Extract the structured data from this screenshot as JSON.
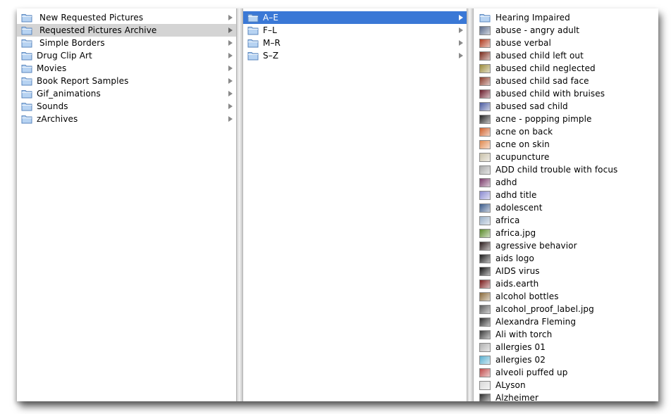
{
  "columns": [
    {
      "items": [
        {
          "label": "New Requested Pictures",
          "type": "folder",
          "padded": true
        },
        {
          "label": "Requested Pictures Archive",
          "type": "folder",
          "padded": true,
          "state": "selected-inactive"
        },
        {
          "label": "Simple Borders",
          "type": "folder",
          "padded": true
        },
        {
          "label": "Drug Clip Art",
          "type": "folder"
        },
        {
          "label": "Movies",
          "type": "folder"
        },
        {
          "label": "Book Report Samples",
          "type": "folder"
        },
        {
          "label": "Gif_animations",
          "type": "folder"
        },
        {
          "label": "Sounds",
          "type": "folder"
        },
        {
          "label": "zArchives",
          "type": "folder"
        }
      ]
    },
    {
      "items": [
        {
          "label": "A–E",
          "type": "folder",
          "state": "selected-active"
        },
        {
          "label": "F–L",
          "type": "folder"
        },
        {
          "label": "M–R",
          "type": "folder"
        },
        {
          "label": "S–Z",
          "type": "folder"
        }
      ]
    },
    {
      "items": [
        {
          "label": "Hearing Impaired",
          "type": "folder"
        },
        {
          "label": "abuse - angry adult",
          "type": "image",
          "color": "#5a6a8a"
        },
        {
          "label": "abuse verbal",
          "type": "image",
          "color": "#b03a1e"
        },
        {
          "label": "abused child left out",
          "type": "image",
          "color": "#7a2a1a"
        },
        {
          "label": "abused child neglected",
          "type": "image",
          "color": "#9a8a3a"
        },
        {
          "label": "abused child sad face",
          "type": "image",
          "color": "#8a3a2a"
        },
        {
          "label": "abused child with bruises",
          "type": "image",
          "color": "#6a1a2a"
        },
        {
          "label": "abused sad child",
          "type": "image",
          "color": "#4a5aa0"
        },
        {
          "label": "acne - popping pimple",
          "type": "image",
          "color": "#222222"
        },
        {
          "label": "acne on back",
          "type": "image",
          "color": "#d0602a"
        },
        {
          "label": "acne on skin",
          "type": "image",
          "color": "#e08a50"
        },
        {
          "label": "acupuncture",
          "type": "image",
          "color": "#c8c0a8"
        },
        {
          "label": "ADD child trouble with focus",
          "type": "image",
          "color": "#a8a8a8"
        },
        {
          "label": "adhd",
          "type": "image",
          "color": "#7a3a6a"
        },
        {
          "label": "adhd title",
          "type": "image",
          "color": "#8a8ad0"
        },
        {
          "label": "adolescent",
          "type": "image",
          "color": "#3a5a8a"
        },
        {
          "label": "africa",
          "type": "image",
          "color": "#9ab0c8"
        },
        {
          "label": "africa.jpg",
          "type": "image",
          "color": "#5a8a2a"
        },
        {
          "label": "agressive behavior",
          "type": "image",
          "color": "#2a1a1a"
        },
        {
          "label": "aids logo",
          "type": "image",
          "color": "#1a1a1a"
        },
        {
          "label": "AIDS virus",
          "type": "image",
          "color": "#101010"
        },
        {
          "label": "aids.earth",
          "type": "image",
          "color": "#7a1a1a"
        },
        {
          "label": "alcohol bottles",
          "type": "image",
          "color": "#8a6a3a"
        },
        {
          "label": "alcohol_proof_label.jpg",
          "type": "image",
          "color": "#5a5a5a"
        },
        {
          "label": "Alexandra Fleming",
          "type": "image",
          "color": "#2a2a2a"
        },
        {
          "label": "Ali with torch",
          "type": "image",
          "color": "#3a3a3a"
        },
        {
          "label": "allergies 01",
          "type": "image",
          "color": "#b0b0b0"
        },
        {
          "label": "allergies 02",
          "type": "image",
          "color": "#5ab0d0"
        },
        {
          "label": "alveoli puffed up",
          "type": "image",
          "color": "#c04a4a"
        },
        {
          "label": "ALyson",
          "type": "image",
          "color": "#d8d8d8"
        },
        {
          "label": "Alzheimer",
          "type": "image",
          "color": "#2a2a2a"
        }
      ]
    }
  ],
  "colors": {
    "selection_active": "#3a78d6",
    "selection_inactive": "#d4d4d4",
    "folder_fill": "#b7d3f2",
    "folder_stroke": "#5a86bd"
  }
}
